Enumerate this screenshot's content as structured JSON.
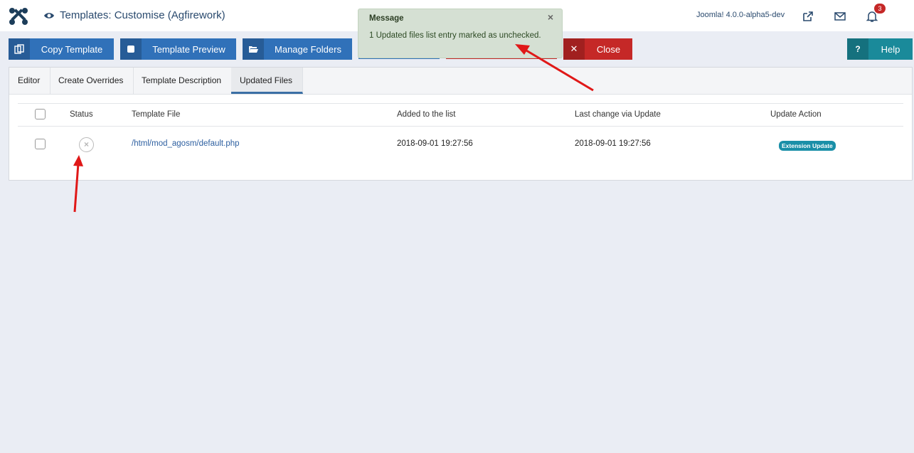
{
  "header": {
    "title": "Templates: Customise (Agfirework)",
    "version": "Joomla! 4.0.0-alpha5-dev",
    "notification_count": "3"
  },
  "toolbar": {
    "copy_template": "Copy Template",
    "template_preview": "Template Preview",
    "manage_folders": "Manage Folders",
    "close": "Close",
    "help": "Help"
  },
  "message": {
    "heading": "Message",
    "text": "1 Updated files list entry marked as unchecked.",
    "close_glyph": "×"
  },
  "tabs": [
    "Editor",
    "Create Overrides",
    "Template Description",
    "Updated Files"
  ],
  "active_tab": "Updated Files",
  "table": {
    "columns": [
      "Status",
      "Template File",
      "Added to the list",
      "Last change via Update",
      "Update Action"
    ],
    "rows": [
      {
        "file": "/html/mod_agosm/default.php",
        "added": "2018-09-01 19:27:56",
        "last_change": "2018-09-01 19:27:56",
        "action": "Extension Update",
        "status_glyph": "×"
      }
    ]
  },
  "colors": {
    "primary": "#3071b9",
    "danger": "#c52827",
    "info": "#1a8a9a",
    "annotation": "#e01818"
  },
  "icons": {
    "logo": "joomla-logo-icon",
    "eye": "eye-icon",
    "external": "external-link-icon",
    "mail": "envelope-icon",
    "bell": "bell-icon",
    "copy": "copy-icon",
    "preview": "square-icon",
    "folder": "folder-open-icon",
    "close": "close-icon",
    "help": "question-icon"
  }
}
